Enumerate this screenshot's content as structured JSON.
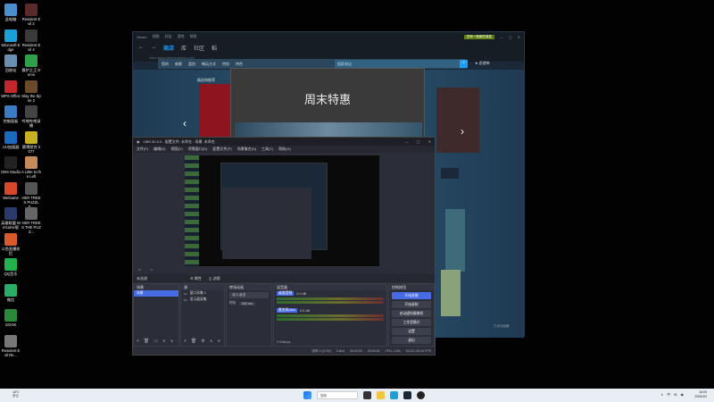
{
  "desktop": {
    "icons": [
      {
        "label": "此电脑",
        "color": "#4b8fd1"
      },
      {
        "label": "Resident Evil 2",
        "color": "#5a2a2a"
      },
      {
        "label": "Microsoft Edge",
        "color": "#1aa1d7"
      },
      {
        "label": "Resident Evil 4",
        "color": "#3a3a3a"
      },
      {
        "label": "回收站",
        "color": "#6a8fb0"
      },
      {
        "label": "舞铲之王 Demo",
        "color": "#2ea04a"
      },
      {
        "label": "WPS Office",
        "color": "#c4262e"
      },
      {
        "label": "Slay the Spire 2",
        "color": "#6a4a2a"
      },
      {
        "label": "控制面板",
        "color": "#3b7bc4"
      },
      {
        "label": "哔哩哔哩录播",
        "color": "#444"
      },
      {
        "label": "UU加速器",
        "color": "#1a6ac0"
      },
      {
        "label": "赛博朋克 2077",
        "color": "#c8b020"
      },
      {
        "label": "OBS Studio",
        "color": "#222"
      },
      {
        "label": "A Little to the Left",
        "color": "#c88a5a"
      },
      {
        "label": "WeGame",
        "color": "#d8482a"
      },
      {
        "label": "HER TREES PUZZLE...",
        "color": "#555"
      },
      {
        "label": "英雄联盟 WeGame版",
        "color": "#2a3a6a"
      },
      {
        "label": "HER TREES THE PUZZ...",
        "color": "#666"
      },
      {
        "label": "斗鱼直播伴侣",
        "color": "#d85a2a"
      },
      {
        "label": "QQ音乐",
        "color": "#22b14c"
      },
      {
        "label": "微信",
        "color": "#2aae67"
      },
      {
        "label": "GOOK",
        "color": "#2a8a3a"
      },
      {
        "label": "Resident Evil Re...",
        "color": "#777"
      }
    ]
  },
  "steam": {
    "title_items": [
      "Steam",
      "视图",
      "好友",
      "游戏",
      "帮助"
    ],
    "nav": {
      "back": "←",
      "forward": "→",
      "tabs": [
        "商店",
        "库",
        "社区",
        "稻"
      ],
      "active_tab": "商店"
    },
    "url": "https://store.steampowered.com/",
    "store_menu": [
      "您的",
      "新鲜",
      "类别",
      "畅玩方式",
      "特别",
      "特色"
    ],
    "search_placeholder": "搜索商店",
    "wishlist": "★ 愿望单",
    "featured_label": "精选和推荐",
    "top_right": {
      "notice": "您有一条新的消息",
      "buttons": [
        "—",
        "▢",
        "✕"
      ]
    },
    "bottom_right": "已设为隐藏",
    "accent": "#1a9fff"
  },
  "popup": {
    "title": "周末特惠"
  },
  "obs": {
    "title": "OBS 32.0.0 - 配置文件: 未命名 - 场景: 未命名",
    "window_buttons": [
      "—",
      "▢",
      "✕"
    ],
    "menu": [
      "文件(F)",
      "编辑(E)",
      "视图(V)",
      "停靠窗口(D)",
      "配置文件(P)",
      "场景集合(S)",
      "工具(T)",
      "帮助(H)"
    ],
    "preview_bar": [
      "⊕",
      "▭"
    ],
    "scene_bar": {
      "label": "未选源",
      "btn1": "⚙ 属性",
      "btn2": "◫ 滤镜"
    },
    "scenes": {
      "header": "场景",
      "items": [
        "场景"
      ],
      "footer": [
        "+",
        "🗑",
        "▭",
        "∧",
        "∨"
      ]
    },
    "sources": {
      "header": "源",
      "items": [
        "窗口采集 1",
        "显示器采集"
      ],
      "footer": [
        "+",
        "🗑",
        "⚙",
        "∧",
        "∨"
      ]
    },
    "transitions": {
      "header": "转场动画",
      "type": "淡入淡出",
      "duration_label": "时长",
      "duration": "300 ms"
    },
    "mixer": {
      "header": "混音器",
      "channels": [
        {
          "name": "桌面音频",
          "db": "0.0 dB"
        },
        {
          "name": "麦克风/Aux",
          "db": "0.0 dB"
        }
      ],
      "status": "0 Hotkeys"
    },
    "controls": {
      "header": "控制按钮",
      "buttons": [
        "开始直播",
        "开始录制",
        "启动虚拟摄像机",
        "工作室模式",
        "设置",
        "退出"
      ]
    },
    "status": [
      "帧率 0 (0.0%)",
      "0 kb/s",
      "00:00:00",
      "00:00:00",
      "CPU: 2.8%",
      "60.00 / 60.00 FPS"
    ]
  },
  "taskbar": {
    "weather_temp": "18°C",
    "weather_desc": "多云",
    "search": "搜索",
    "time": "16:09",
    "date": "2025/4/3",
    "tray": [
      "∧",
      "中",
      "⊞",
      "◉"
    ]
  }
}
